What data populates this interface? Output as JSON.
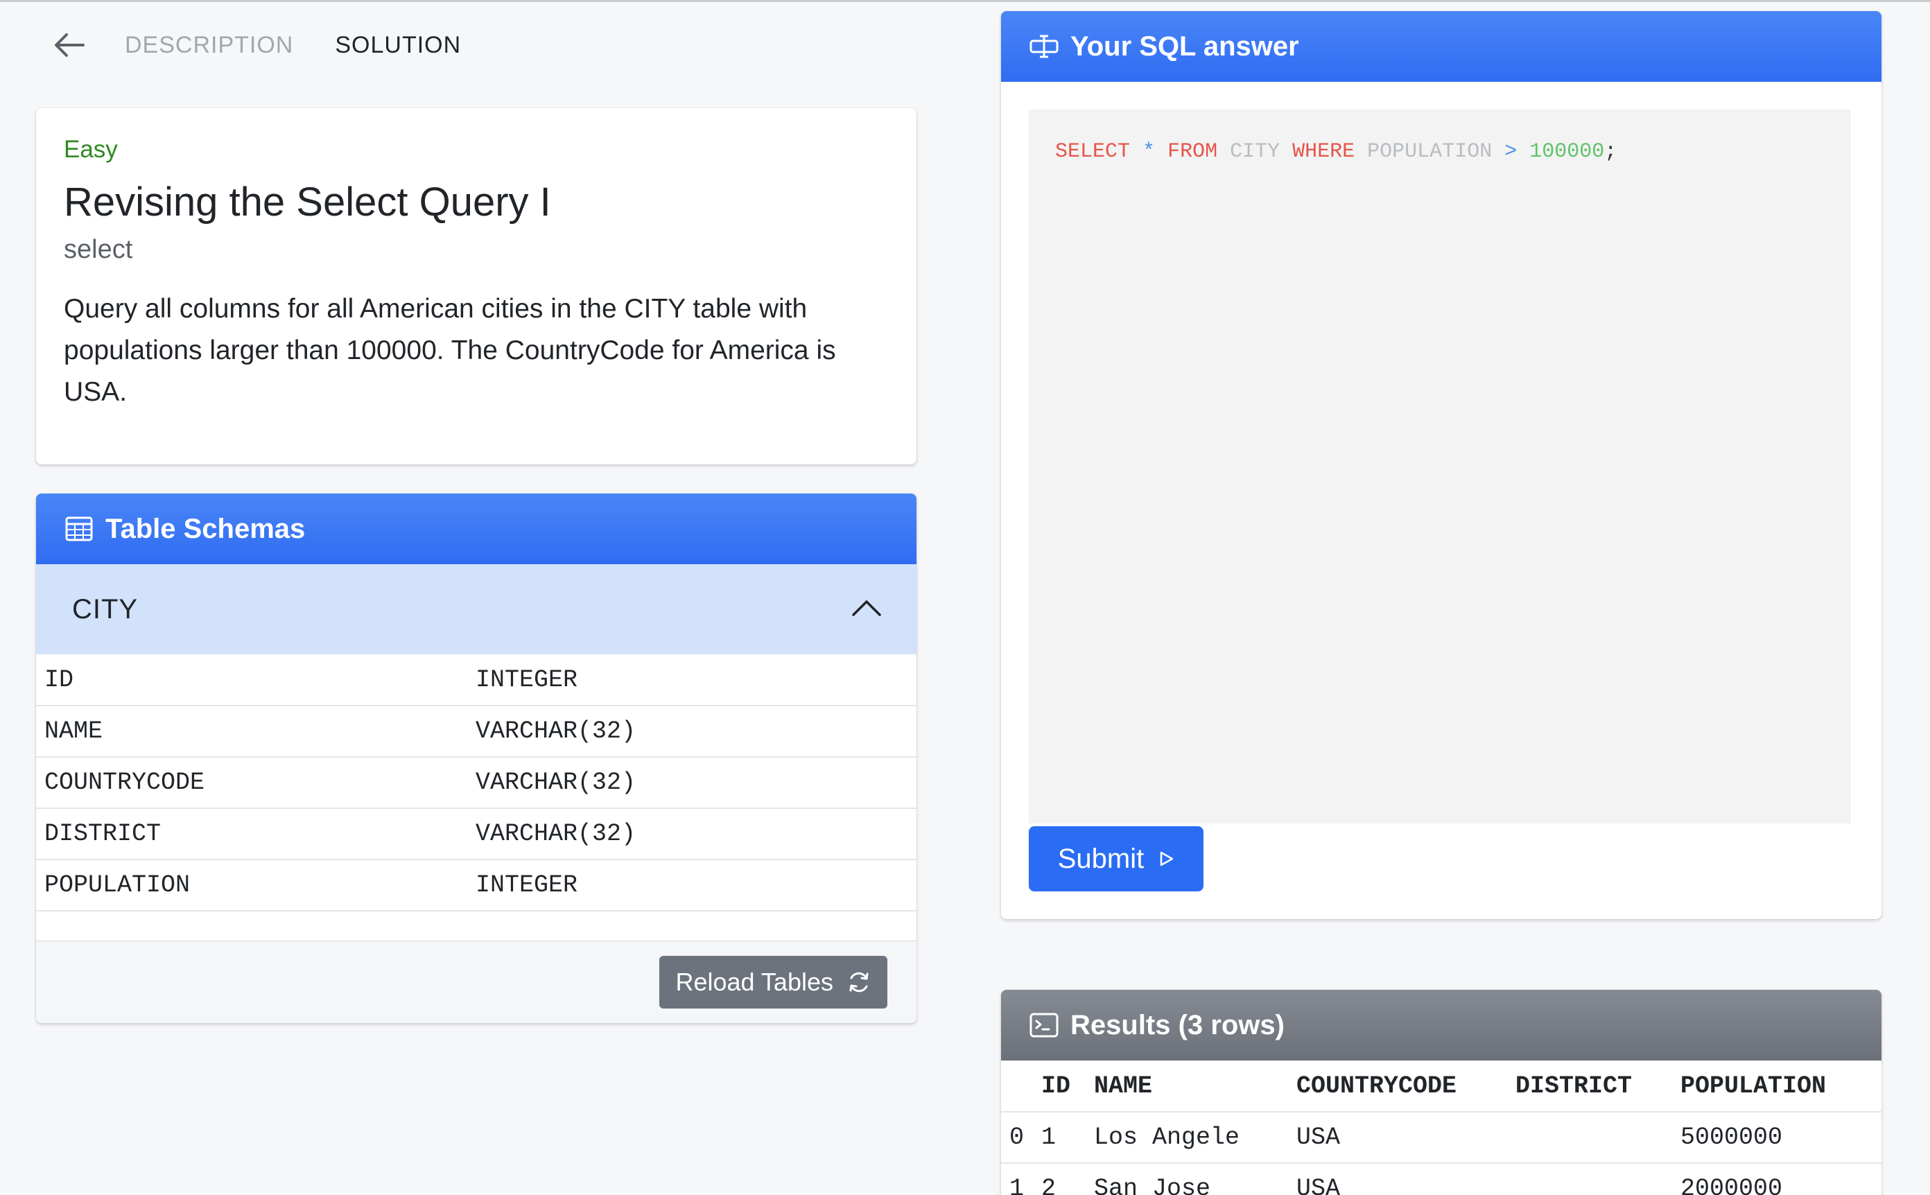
{
  "nav": {
    "tabs": [
      {
        "label": "DESCRIPTION",
        "active": false
      },
      {
        "label": "SOLUTION",
        "active": true
      }
    ]
  },
  "problem": {
    "difficulty": "Easy",
    "title": "Revising the Select Query I",
    "tag": "select",
    "description": "Query all columns for all American cities in the CITY table with populations larger than 100000. The CountryCode for America is USA."
  },
  "schemas": {
    "header": "Table Schemas",
    "table_name": "CITY",
    "columns": [
      {
        "name": "ID",
        "type": "INTEGER"
      },
      {
        "name": "NAME",
        "type": "VARCHAR(32)"
      },
      {
        "name": "COUNTRYCODE",
        "type": "VARCHAR(32)"
      },
      {
        "name": "DISTRICT",
        "type": "VARCHAR(32)"
      },
      {
        "name": "POPULATION",
        "type": "INTEGER"
      }
    ],
    "reload_label": "Reload Tables"
  },
  "answer": {
    "header": "Your SQL answer",
    "query_tokens": {
      "select": "SELECT",
      "star": "*",
      "from": "FROM",
      "table": "CITY",
      "where": "WHERE",
      "column": "POPULATION",
      "op": ">",
      "value": "100000",
      "semi": ";"
    },
    "submit_label": "Submit"
  },
  "results": {
    "header": "Results (3 rows)",
    "columns": [
      "",
      "ID",
      "NAME",
      "COUNTRYCODE",
      "DISTRICT",
      "POPULATION"
    ],
    "rows": [
      [
        "0",
        "1",
        "Los Angele",
        "USA",
        "",
        "5000000"
      ],
      [
        "1",
        "2",
        "San Jose",
        "USA",
        "",
        "2000000"
      ]
    ]
  },
  "colors": {
    "accent_blue": "#2f6cf2",
    "difficulty_green": "#2e8b20",
    "accordion_bg": "#d3e2fb",
    "results_header": "#6b7079"
  }
}
